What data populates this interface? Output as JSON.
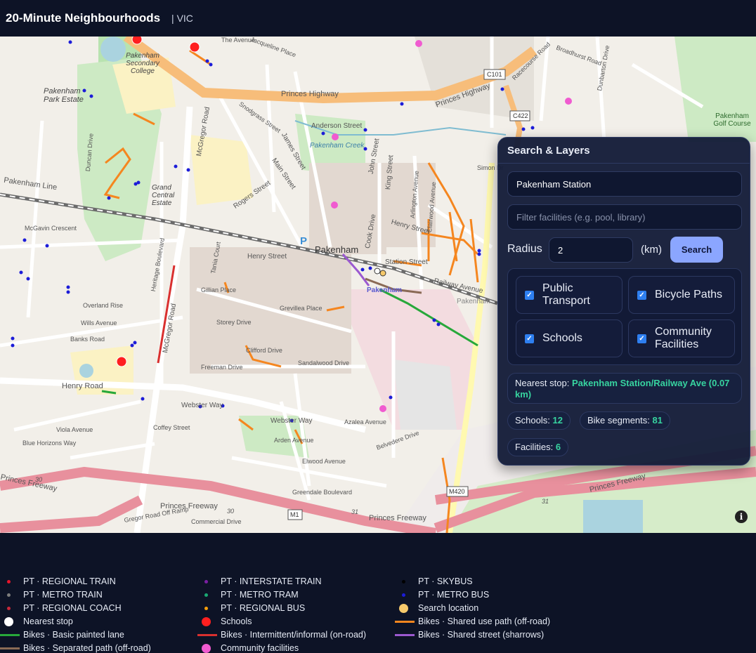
{
  "header": {
    "title": "20-Minute Neighbourhoods",
    "region": "| VIC"
  },
  "map": {
    "labels": {
      "pakenham": "Pakenham",
      "pakenham_station": "Pakenham",
      "princes_highway": "Princes Highway",
      "princes_highway_2": "Princes Highway",
      "princes_freeway": "Princes Freeway",
      "princes_freeway_2": "Princes Freeway",
      "princes_freeway_3": "Princes Freeway",
      "princes_freeway_4": "Princes Freeway",
      "henry_road": "Henry Road",
      "henry_street": "Henry Street",
      "webster_way": "Webster Way",
      "webster_way_2": "Webster Way",
      "main_street": "Main Street",
      "mcgregor_road": "McGregor Road",
      "mcgregor_road_2": "McGregor Road",
      "pakenham_line": "Pakenham Line",
      "pakenham_park_estate": "Pakenham Park Estate",
      "pakenham_secondary_college": "Pakenham Secondary College",
      "grand_central_estate": "Grand Central Estate",
      "pakenham_golf_course": "Pakenham Golf Course",
      "station_street": "Station Street",
      "railway_avenue": "Railway Avenue",
      "anderson_street": "Anderson Street",
      "pakenham_creek": "Pakenham Creek",
      "john_street": "John Street",
      "king_street": "King Street",
      "rogers_street": "Rogers Street",
      "james_street": "James Street",
      "cook_drive": "Cook Drive",
      "c101": "C101",
      "c422": "C422",
      "m420": "M420",
      "m1": "M1",
      "m30a": "30",
      "m30b": "30",
      "m31a": "31",
      "m31b": "31",
      "greendale": "Greendale Boulevard",
      "commercial_drive": "Commercial Drive",
      "coffey_street": "Coffey Street",
      "storey_drive": "Storey Drive",
      "clifford_drive": "Clifford Drive",
      "freeman_drive": "Freeman Drive",
      "sandalwood_drive": "Sandalwood Drive",
      "arden_avenue": "Arden Avenue",
      "azalea_avenue": "Azalea Avenue",
      "belvedere_drive": "Belvedere Drive",
      "elwood_avenue": "Elwood Avenue",
      "overland_rise": "Overland Rise",
      "wills_avenue": "Wills Avenue",
      "banks_road": "Banks Road",
      "duncan_drive": "Duncan Drive",
      "gillian_place": "Gillian Place",
      "grevillea_place": "Grevillea Place",
      "heritage_boulevard": "Heritage Boulevard",
      "tania_court": "Tania Court",
      "viola_avenue": "Viola Avenue",
      "blue_horizons_way": "Blue Horizons Way",
      "mcgavin_crescent": "McGavin Crescent",
      "jacqueline_place": "Jacqueline Place",
      "the_avenue": "The Avenue",
      "snodgrass_street": "Snodgrass Street",
      "henry_street_2": "Henry Street",
      "dunbarton_drive": "Dunbarton Drive",
      "broadhurst_road": "Broadhurst Road",
      "racecourse_road": "Racecourse Road",
      "simon_dr": "Simon Dr",
      "arlington_avenue": "Arlington Avenue",
      "clairwood_avenue": "Clairwood Avenue",
      "gregor_ramp": "Gregor Road Off Ramp",
      "pakenham_st_label": "Pakenham"
    }
  },
  "panel": {
    "title": "Search & Layers",
    "location_value": "Pakenham Station",
    "filter_placeholder": "Filter facilities (e.g. pool, library)",
    "radius_label": "Radius",
    "radius_value": "2",
    "radius_unit": "(km)",
    "search_label": "Search",
    "layers": [
      {
        "label": "Public Transport",
        "checked": true
      },
      {
        "label": "Bicycle Paths",
        "checked": true
      },
      {
        "label": "Schools",
        "checked": true
      },
      {
        "label": "Community Facilities",
        "checked": true
      }
    ],
    "nearest_prefix": "Nearest stop:",
    "nearest_value": "Pakenham Station/Railway Ave (0.07 km)",
    "stats": {
      "schools_label": "Schools:",
      "schools_value": "12",
      "bike_label": "Bike segments:",
      "bike_value": "81",
      "facilities_label": "Facilities:",
      "facilities_value": "6"
    }
  },
  "legend": [
    {
      "label": "PT · REGIONAL TRAIN",
      "kind": "dot",
      "color": "#e8142a"
    },
    {
      "label": "PT · INTERSTATE TRAIN",
      "kind": "dot",
      "color": "#7a1fa2"
    },
    {
      "label": "PT · SKYBUS",
      "kind": "dot",
      "color": "#000000"
    },
    {
      "label": "PT · METRO TRAIN",
      "kind": "dot",
      "color": "#7d7d7d"
    },
    {
      "label": "PT · METRO TRAM",
      "kind": "dot",
      "color": "#1aa873"
    },
    {
      "label": "PT · METRO BUS",
      "kind": "dot",
      "color": "#1c1cd8"
    },
    {
      "label": "PT · REGIONAL COACH",
      "kind": "dot",
      "color": "#c9283a"
    },
    {
      "label": "PT · REGIONAL BUS",
      "kind": "dot",
      "color": "#f59e0b"
    },
    {
      "label": "Search location",
      "kind": "bigdot",
      "color": "#f6c96b"
    },
    {
      "label": "Nearest stop",
      "kind": "bigdot",
      "color": "#ffffff"
    },
    {
      "label": "Schools",
      "kind": "bigdot",
      "color": "#ff1f1f"
    },
    {
      "label": "Bikes · Shared use path (off-road)",
      "kind": "line",
      "color": "#f5861f"
    },
    {
      "label": "Bikes · Basic painted lane",
      "kind": "line",
      "color": "#27a83a"
    },
    {
      "label": "Bikes · Intermittent/informal (on-road)",
      "kind": "line",
      "color": "#d9302f"
    },
    {
      "label": "Bikes · Shared street (sharrows)",
      "kind": "line",
      "color": "#9b59d0"
    },
    {
      "label": "Bikes · Separated path (off-road)",
      "kind": "line",
      "color": "#8a6a55"
    },
    {
      "label": "Community facilities",
      "kind": "bigdot",
      "color": "#f05bd0"
    }
  ]
}
